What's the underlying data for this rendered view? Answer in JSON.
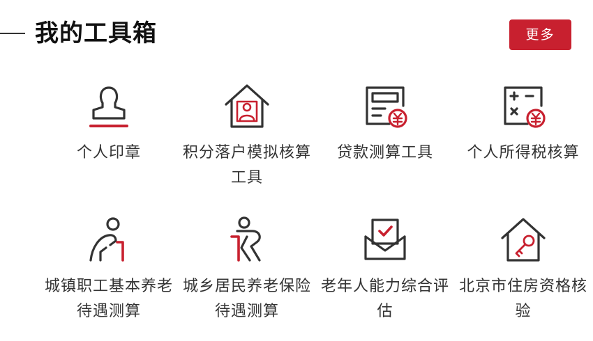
{
  "header": {
    "title": "我的工具箱",
    "more_label": "更多"
  },
  "colors": {
    "accent": "#c8202f",
    "icon_stroke": "#333333",
    "text": "#333333"
  },
  "tools": [
    {
      "label": "个人印章",
      "icon": "stamp-icon"
    },
    {
      "label": "积分落户模拟核算工具",
      "icon": "house-person-icon"
    },
    {
      "label": "贷款测算工具",
      "icon": "loan-calculator-icon"
    },
    {
      "label": "个人所得税核算",
      "icon": "tax-calculator-icon"
    },
    {
      "label": "城镇职工基本养老待遇测算",
      "icon": "elderly-person-icon"
    },
    {
      "label": "城乡居民养老保险待遇测算",
      "icon": "elderly-cane-icon"
    },
    {
      "label": "老年人能力综合评估",
      "icon": "assessment-envelope-icon"
    },
    {
      "label": "北京市住房资格核验",
      "icon": "house-key-icon"
    }
  ]
}
